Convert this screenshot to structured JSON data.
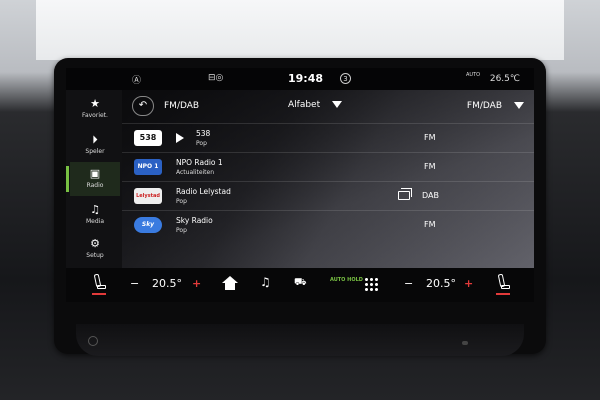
{
  "status_bar": {
    "time": "19:48",
    "notification_count": "3",
    "climate_mode": "AUTO",
    "outside_temp": "26.5℃"
  },
  "sidebar": {
    "items": [
      {
        "label": "Favoriet.",
        "icon": "star-icon"
      },
      {
        "label": "Speler",
        "icon": "play-circle-icon"
      },
      {
        "label": "Radio",
        "icon": "radio-icon",
        "active": true
      },
      {
        "label": "Media",
        "icon": "music-note-icon"
      },
      {
        "label": "Setup",
        "icon": "gear-icon"
      }
    ]
  },
  "header": {
    "source": "FM/DAB",
    "sort": "Alfabet",
    "band_filter": "FM/DAB"
  },
  "stations": [
    {
      "logo": "538",
      "name": "538",
      "genre": "Pop",
      "band": "FM",
      "playing": true
    },
    {
      "logo": "NPO 1",
      "name": "NPO Radio 1",
      "genre": "Actualiteiten",
      "band": "FM",
      "playing": false
    },
    {
      "logo": "Lelystad",
      "name": "Radio Lelystad",
      "genre": "Pop",
      "band": "DAB",
      "playing": false
    },
    {
      "logo": "Sky",
      "name": "Sky Radio",
      "genre": "Pop",
      "band": "FM",
      "playing": false
    }
  ],
  "climate": {
    "left_temp": "20.5°",
    "right_temp": "20.5°",
    "auto_hold": "AUTO HOLD",
    "minus": "−",
    "plus": "+"
  },
  "colors": {
    "accent_green": "#78c043",
    "heat_red": "#e23a3a"
  }
}
